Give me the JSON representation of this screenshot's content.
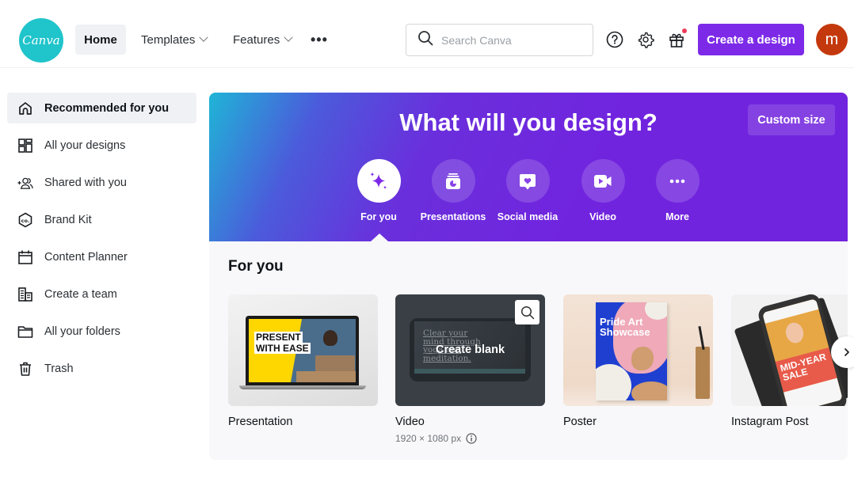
{
  "header": {
    "logo_text": "Canva",
    "nav": {
      "home": "Home",
      "templates": "Templates",
      "features": "Features",
      "more": "•••"
    },
    "search": {
      "placeholder": "Search Canva",
      "value": ""
    },
    "icons": [
      "help-icon",
      "settings-icon",
      "gift-icon"
    ],
    "create_button": "Create a design",
    "avatar_initial": "m",
    "colors": {
      "brand": "#20c4cb",
      "accent": "#7d2ae8",
      "avatar": "#c4380d",
      "notification": "#ee3b5a"
    }
  },
  "sidebar": {
    "items": [
      {
        "label": "Recommended for you",
        "icon": "home-icon",
        "active": true
      },
      {
        "label": "All your designs",
        "icon": "grid-icon",
        "active": false
      },
      {
        "label": "Shared with you",
        "icon": "shared-people-icon",
        "active": false
      },
      {
        "label": "Brand Kit",
        "icon": "brand-kit-icon",
        "active": false
      },
      {
        "label": "Content Planner",
        "icon": "calendar-icon",
        "active": false
      },
      {
        "label": "Create a team",
        "icon": "team-building-icon",
        "active": false
      },
      {
        "label": "All your folders",
        "icon": "folder-icon",
        "active": false
      },
      {
        "label": "Trash",
        "icon": "trash-icon",
        "active": false
      }
    ]
  },
  "hero": {
    "title": "What will you design?",
    "custom_size": "Custom size",
    "categories": [
      {
        "label": "For you",
        "icon": "sparkle-icon",
        "active": true
      },
      {
        "label": "Presentations",
        "icon": "presentation-icon",
        "active": false
      },
      {
        "label": "Social media",
        "icon": "heart-chat-icon",
        "active": false
      },
      {
        "label": "Video",
        "icon": "video-camera-icon",
        "active": false
      },
      {
        "label": "More",
        "icon": "more-dots-icon",
        "active": false
      }
    ]
  },
  "for_you": {
    "title": "For you",
    "cards": [
      {
        "label": "Presentation",
        "thumb_text": [
          "PRESENT",
          "WITH EASE"
        ]
      },
      {
        "label": "Video",
        "overlay": "Create blank",
        "subtitle": "1920 × 1080 px",
        "bg_text": [
          "Clear your",
          "mind through",
          "yoga and",
          "meditation."
        ]
      },
      {
        "label": "Poster",
        "thumb_text": [
          "Pride Art",
          "Showcase"
        ]
      },
      {
        "label": "Instagram Post",
        "thumb_text": [
          "MID-YEAR",
          "SALE"
        ]
      }
    ]
  }
}
